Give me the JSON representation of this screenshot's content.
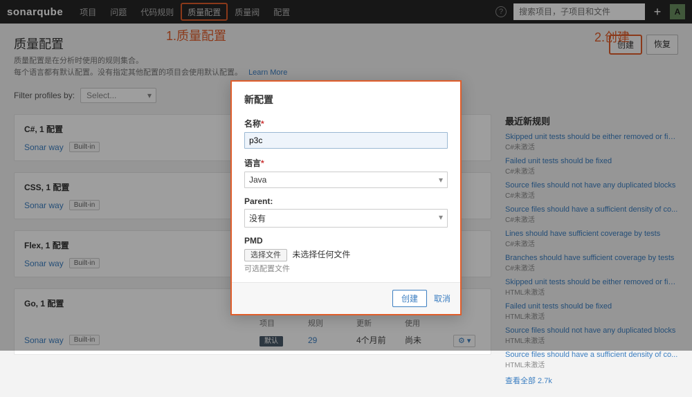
{
  "nav": {
    "brand": "sonarqube",
    "items": [
      "项目",
      "问题",
      "代码规则",
      "质量配置",
      "质量阀",
      "配置"
    ],
    "search_placeholder": "搜索项目，子项目和文件",
    "avatar": "A"
  },
  "annotations": {
    "a1": "1.质量配置",
    "a2": "2.创建"
  },
  "header": {
    "title": "质量配置",
    "desc1": "质量配置是在分析时使用的规则集合。",
    "desc2": "每个语言都有默认配置。没有指定其他配置的项目会使用默认配置。",
    "learn_more": "Learn More",
    "create": "创建",
    "restore": "恢复"
  },
  "filter": {
    "label": "Filter profiles by:",
    "select": "Select..."
  },
  "profiles": [
    {
      "title": "C#, 1 配置",
      "name": "Sonar way",
      "badge": "Built-in"
    },
    {
      "title": "CSS, 1 配置",
      "name": "Sonar way",
      "badge": "Built-in"
    },
    {
      "title": "Flex, 1 配置",
      "name": "Sonar way",
      "badge": "Built-in"
    }
  ],
  "go_block": {
    "title": "Go, 1 配置",
    "cols": [
      "项目",
      "规则",
      "更新",
      "使用"
    ],
    "name": "Sonar way",
    "badge": "Built-in",
    "default_badge": "默认",
    "rules": "29",
    "updated": "4个月前",
    "used": "尚未"
  },
  "sidebar": {
    "title": "最近新规则",
    "view_all": "查看全部 2.7k",
    "rules": [
      {
        "t": "Skipped unit tests should be either removed or fix...",
        "s": "C#未激活"
      },
      {
        "t": "Failed unit tests should be fixed",
        "s": "C#未激活"
      },
      {
        "t": "Source files should not have any duplicated blocks",
        "s": "C#未激活"
      },
      {
        "t": "Source files should have a sufficient density of co...",
        "s": "C#未激活"
      },
      {
        "t": "Lines should have sufficient coverage by tests",
        "s": "C#未激活"
      },
      {
        "t": "Branches should have sufficient coverage by tests",
        "s": "C#未激活"
      },
      {
        "t": "Skipped unit tests should be either removed or fix...",
        "s": "HTML未激活"
      },
      {
        "t": "Failed unit tests should be fixed",
        "s": "HTML未激活"
      },
      {
        "t": "Source files should not have any duplicated blocks",
        "s": "HTML未激活"
      },
      {
        "t": "Source files should have a sufficient density of co...",
        "s": "HTML未激活"
      }
    ]
  },
  "modal": {
    "title": "新配置",
    "name_label": "名称",
    "name_value": "p3c",
    "lang_label": "语言",
    "lang_value": "Java",
    "parent_label": "Parent:",
    "parent_value": "没有",
    "pmd_label": "PMD",
    "file_btn": "选择文件",
    "file_text": "未选择任何文件",
    "hint": "可选配置文件",
    "submit": "创建",
    "cancel": "取消"
  }
}
